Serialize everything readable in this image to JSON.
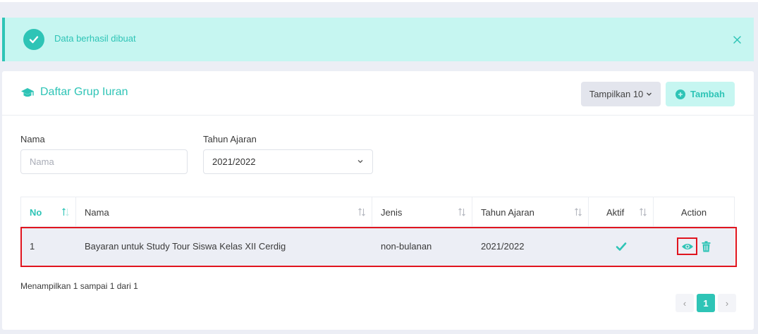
{
  "alert": {
    "message": "Data berhasil dibuat"
  },
  "card": {
    "title": "Daftar Grup Iuran",
    "show_button_label": "Tampilkan 10",
    "add_button_label": "Tambah"
  },
  "filters": {
    "nama_label": "Nama",
    "nama_placeholder": "Nama",
    "nama_value": "",
    "tahun_label": "Tahun Ajaran",
    "tahun_value": "2021/2022"
  },
  "table": {
    "columns": [
      "No",
      "Nama",
      "Jenis",
      "Tahun Ajaran",
      "Aktif",
      "Action"
    ],
    "rows": [
      {
        "no": "1",
        "nama": "Bayaran untuk Study Tour Siswa Kelas XII Cerdig",
        "jenis": "non-bulanan",
        "tahun": "2021/2022",
        "aktif": true
      }
    ]
  },
  "footer": {
    "info": "Menampilkan 1 sampai 1 dari 1",
    "current_page": "1",
    "prev_glyph": "‹",
    "next_glyph": "›"
  },
  "colors": {
    "accent": "#2ec4b6",
    "alert_bg": "#c6f6f1",
    "highlight": "#e0141e",
    "row_bg": "#eceef5"
  },
  "icons": {
    "alert": "check-circle-icon",
    "close": "close-icon",
    "title": "graduation-cap-icon",
    "add": "plus-circle-icon",
    "sort": "sort-icon",
    "active": "check-icon",
    "view": "eye-icon",
    "delete": "trash-icon"
  }
}
